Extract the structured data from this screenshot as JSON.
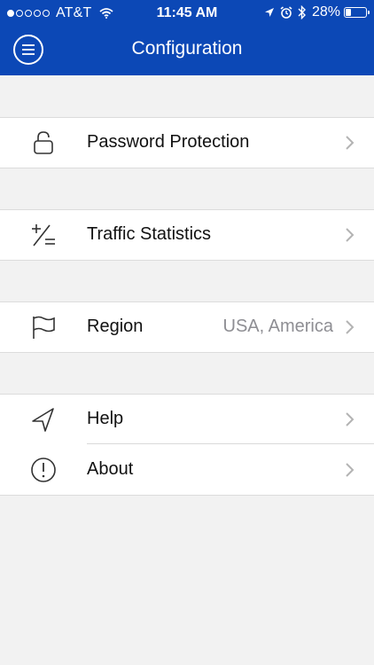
{
  "status_bar": {
    "carrier": "AT&T",
    "time": "11:45 AM",
    "battery_percent": "28%",
    "battery_level": 0.28,
    "signal_bars_filled": 1,
    "signal_bars_total": 5
  },
  "header": {
    "title": "Configuration",
    "menu_icon": "menu-icon",
    "background_color": "#0c48b6"
  },
  "sections": [
    {
      "rows": [
        {
          "label": "Password Protection",
          "icon": "lock-icon",
          "value": ""
        }
      ]
    },
    {
      "rows": [
        {
          "label": "Traffic Statistics",
          "icon": "plus-minus-icon",
          "value": ""
        }
      ]
    },
    {
      "rows": [
        {
          "label": "Region",
          "icon": "flag-icon",
          "value": "USA, America"
        }
      ]
    },
    {
      "rows": [
        {
          "label": "Help",
          "icon": "navigation-arrow-icon",
          "value": ""
        },
        {
          "label": "About",
          "icon": "info-exclamation-icon",
          "value": ""
        }
      ]
    }
  ]
}
